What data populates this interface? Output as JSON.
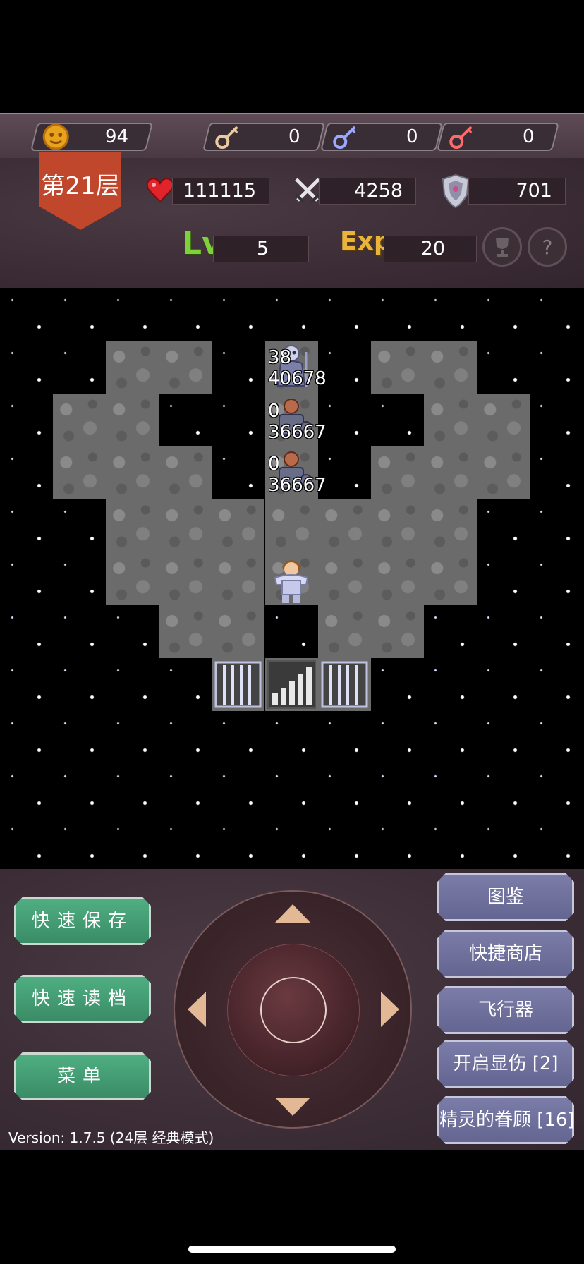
{
  "resources": {
    "gold": "94",
    "yellow_key": "0",
    "blue_key": "0",
    "red_key": "0"
  },
  "floor": {
    "label": "第21层"
  },
  "stats": {
    "hp": "111115",
    "attack": "4258",
    "defense": "701",
    "level_label": "Lv",
    "level": "5",
    "exp_label": "Exp",
    "exp": "20"
  },
  "monsters": [
    {
      "name": "skeleton-mage",
      "line1": "38",
      "line2": "40678"
    },
    {
      "name": "red-knight-1",
      "line1": "0",
      "line2": "36667"
    },
    {
      "name": "red-knight-2",
      "line1": "0",
      "line2": "36667"
    }
  ],
  "buttons_left": {
    "quick_save": "快速保存",
    "quick_load": "快速读档",
    "menu": "菜单"
  },
  "buttons_right": {
    "encyclopedia": "图鉴",
    "quick_shop": "快捷商店",
    "flyer": "飞行器",
    "show_damage": "开启显伤 [2]",
    "fairy_favor": "精灵的眷顾 [16]"
  },
  "version": "Version: 1.7.5 (24层 经典模式)",
  "colors": {
    "floor_banner": "#c0462c",
    "green_button": "#4fae82",
    "purple_button": "#7b7ca8",
    "level_text": "#7fd13a",
    "exp_text": "#e8b43a"
  }
}
